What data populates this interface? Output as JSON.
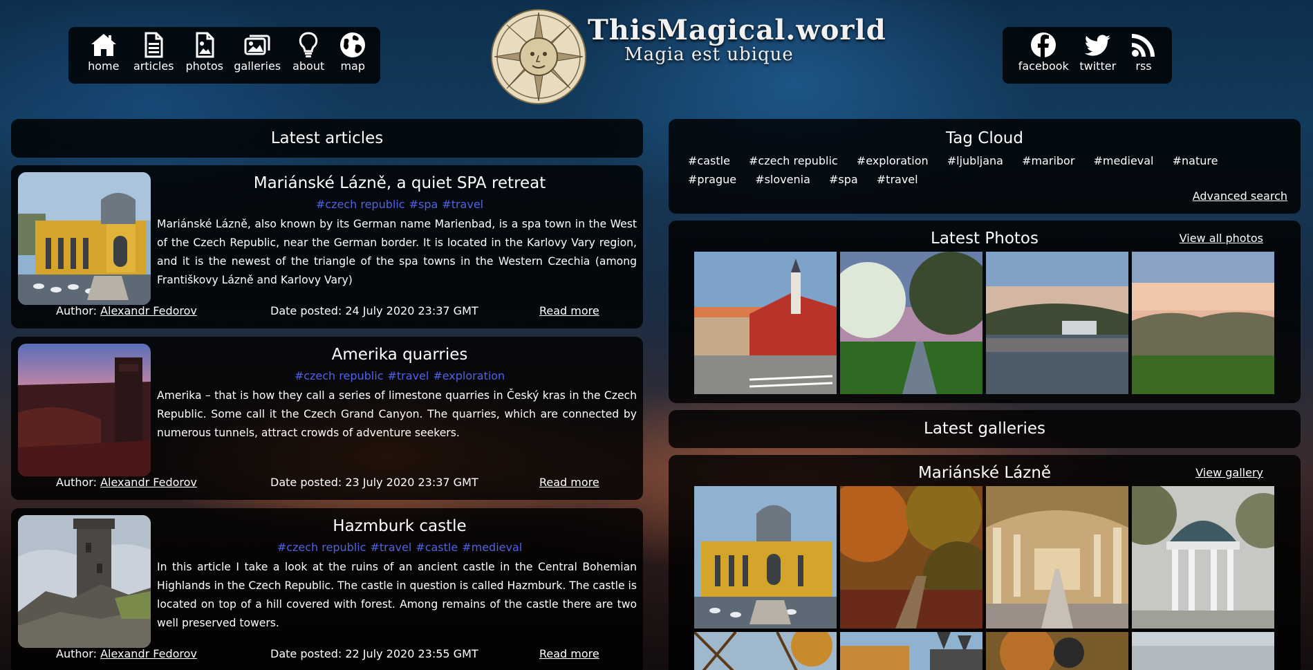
{
  "nav": {
    "items": [
      {
        "label": "home",
        "icon": "home-icon"
      },
      {
        "label": "articles",
        "icon": "document-icon"
      },
      {
        "label": "photos",
        "icon": "photo-file-icon"
      },
      {
        "label": "galleries",
        "icon": "images-icon"
      },
      {
        "label": "about",
        "icon": "lightbulb-icon"
      },
      {
        "label": "map",
        "icon": "globe-icon"
      }
    ]
  },
  "brand": {
    "title": "ThisMagical.world",
    "subtitle": "Magia est ubique"
  },
  "social": {
    "items": [
      {
        "label": "facebook",
        "icon": "facebook-icon"
      },
      {
        "label": "twitter",
        "icon": "twitter-icon"
      },
      {
        "label": "rss",
        "icon": "rss-icon"
      }
    ]
  },
  "latest_articles": {
    "title": "Latest articles",
    "items": [
      {
        "title": "Mariánské Lázně, a quiet SPA retreat",
        "tags": [
          "#czech republic",
          "#spa",
          "#travel"
        ],
        "text": "Mariánské Lázně, also known by its German name Marienbad, is a spa town in the West of the Czech Republic, near the German border. It is located in the Karlovy Vary region, and it is the newest of the triangle of the spa towns in the Western Czechia (among Františkovy Lázně and Karlovy Vary)",
        "author_label": "Author:",
        "author": "Alexandr Fedorov",
        "date": "Date posted: 24 July 2020 23:37 GMT",
        "read_more": "Read more"
      },
      {
        "title": "Amerika quarries",
        "tags": [
          "#czech republic",
          "#travel",
          "#exploration"
        ],
        "text": "Amerika – that is how they call a series of limestone quarries in Český kras in the Czech Republic. Some call it the Czech Grand Canyon. The quarries, which are connected by numerous tunnels, attract crowds of adventure seekers.",
        "author_label": "Author:",
        "author": "Alexandr Fedorov",
        "date": "Date posted: 23 July 2020 23:37 GMT",
        "read_more": "Read more"
      },
      {
        "title": "Hazmburk castle",
        "tags": [
          "#czech republic",
          "#travel",
          "#castle",
          "#medieval"
        ],
        "text": "In this article I take a look at the ruins of an ancient castle in the Central Bohemian Highlands in the Czech Republic. The castle in question is called Hazmburk. The castle is located on top of a hill covered with forest. Among remains of the castle there are two well preserved towers.",
        "author_label": "Author:",
        "author": "Alexandr Fedorov",
        "date": "Date posted: 22 July 2020 23:55 GMT",
        "read_more": "Read more"
      }
    ]
  },
  "tag_cloud": {
    "title": "Tag Cloud",
    "tags": [
      "#castle",
      "#czech republic",
      "#exploration",
      "#ljubljana",
      "#maribor",
      "#medieval",
      "#nature",
      "#prague",
      "#slovenia",
      "#spa",
      "#travel"
    ],
    "advanced_search": "Advanced search"
  },
  "latest_photos": {
    "title": "Latest Photos",
    "view_all": "View all photos"
  },
  "latest_galleries": {
    "title": "Latest galleries",
    "gallery_title": "Mariánské Lázně",
    "view_gallery": "View gallery"
  },
  "colors": {
    "tag_link": "#4f63e6",
    "panel_bg": "rgba(0,0,0,0.82)"
  }
}
